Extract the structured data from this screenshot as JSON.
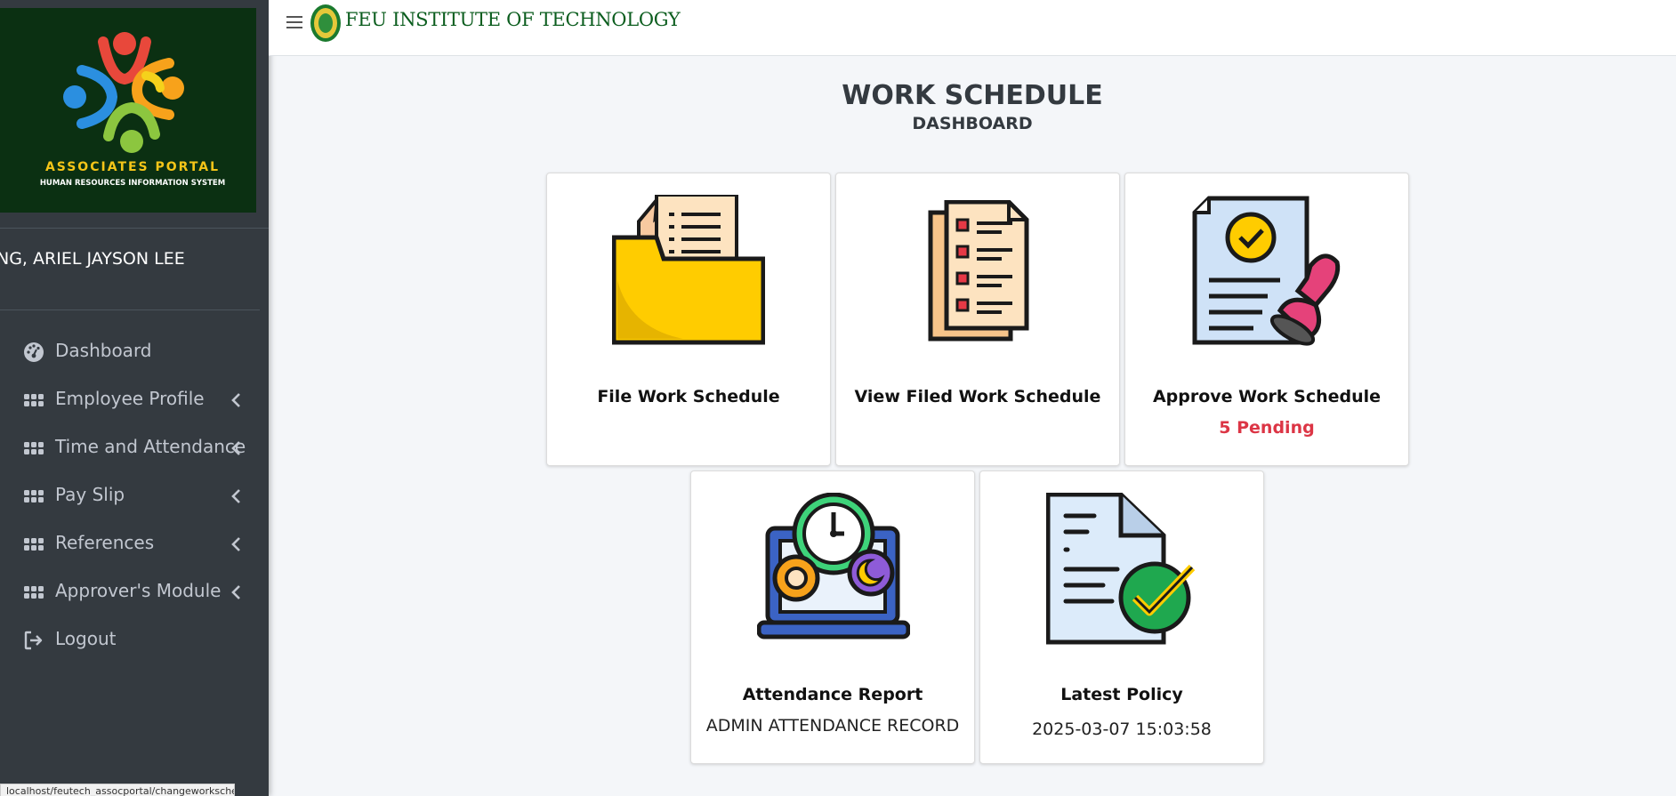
{
  "sidebar": {
    "logo_title": "ASSOCIATES PORTAL",
    "logo_subtitle": "HUMAN RESOURCES INFORMATION SYSTEM",
    "user_name": "NG, ARIEL JAYSON LEE",
    "items": [
      {
        "label": "Dashboard",
        "icon": "dashboard-gauge-icon"
      },
      {
        "label": "Employee Profile",
        "icon": "grid-icon"
      },
      {
        "label": "Time and Attendance",
        "icon": "grid-icon"
      },
      {
        "label": "Pay Slip",
        "icon": "grid-icon"
      },
      {
        "label": "References",
        "icon": "grid-icon"
      },
      {
        "label": "Approver's Module",
        "icon": "grid-icon"
      },
      {
        "label": "Logout",
        "icon": "logout-icon"
      }
    ]
  },
  "status_bar": {
    "url": "localhost/feutech_assocportal/changeworksched"
  },
  "header": {
    "brand": "FEU INSTITUTE OF TECHNOLOGY"
  },
  "page": {
    "title": "WORK SCHEDULE",
    "subtitle": "DASHBOARD"
  },
  "cards": [
    {
      "title": "File Work Schedule",
      "icon": "folder-document-icon"
    },
    {
      "title": "View Filed Work Schedule",
      "icon": "checklist-document-icon"
    },
    {
      "title": "Approve Work Schedule",
      "subtitle": "5 Pending",
      "icon": "approval-stamp-icon"
    },
    {
      "title": "Attendance Report",
      "subtitle": "ADMIN ATTENDANCE RECORD",
      "icon": "laptop-clock-icon"
    },
    {
      "title": "Latest Policy",
      "subtitle": "2025-03-07 15:03:58",
      "icon": "policy-document-check-icon"
    }
  ],
  "colors": {
    "sidebar_bg": "#343a40",
    "logo_bg": "#0b3012",
    "brand_green": "#0b5d1e",
    "pending_red": "#dc3545",
    "page_bg": "#f4f6f9"
  }
}
